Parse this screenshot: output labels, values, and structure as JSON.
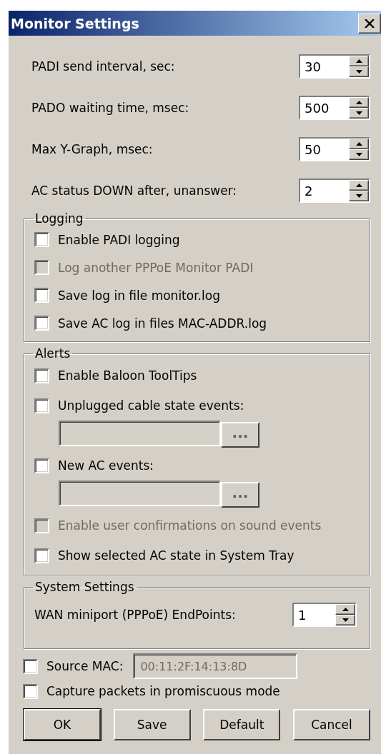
{
  "window": {
    "title": "Monitor Settings"
  },
  "spinners": [
    {
      "label": "PADI send interval, sec:",
      "value": "30"
    },
    {
      "label": "PADO waiting time, msec:",
      "value": "500"
    },
    {
      "label": "Max Y-Graph, msec:",
      "value": "50"
    },
    {
      "label": "AC status DOWN after, unanswer:",
      "value": "2"
    }
  ],
  "logging": {
    "title": "Logging",
    "items": [
      {
        "kind": "checkbox",
        "label": "Enable PADI logging",
        "checked": false,
        "disabled": false
      },
      {
        "kind": "checkbox",
        "label": "Log another PPPoE Monitor PADI",
        "checked": false,
        "disabled": true
      },
      {
        "kind": "checkbox",
        "label": "Save log in file monitor.log",
        "checked": false,
        "disabled": false
      },
      {
        "kind": "checkbox",
        "label": "Save AC log in files MAC-ADDR.log",
        "checked": false,
        "disabled": false
      }
    ]
  },
  "alerts": {
    "title": "Alerts",
    "items": [
      {
        "kind": "checkbox",
        "label": "Enable Baloon ToolTips",
        "checked": false,
        "disabled": false
      },
      {
        "kind": "checkbox",
        "label": "Unplugged cable state events:",
        "checked": false,
        "disabled": false
      },
      {
        "kind": "path",
        "disabled": true,
        "browse": "..."
      },
      {
        "kind": "checkbox",
        "label": "New AC events:",
        "checked": false,
        "disabled": false
      },
      {
        "kind": "path",
        "disabled": true,
        "browse": "..."
      },
      {
        "kind": "checkbox",
        "label": "Enable user confirmations on sound events",
        "checked": false,
        "disabled": true
      },
      {
        "kind": "checkbox",
        "label": "Show selected AC state in System Tray",
        "checked": false,
        "disabled": false
      }
    ]
  },
  "system": {
    "title": "System Settings",
    "spinners": [
      {
        "label": "WAN miniport (PPPoE) EndPoints:",
        "value": "1"
      }
    ]
  },
  "source_mac": {
    "label": "Source MAC:",
    "checked": false,
    "value": "00:11:2F:14:13:8D",
    "disabled": true
  },
  "capture": {
    "label": "Capture packets in promiscuous mode",
    "checked": false
  },
  "buttons": [
    {
      "label": "OK",
      "default": true
    },
    {
      "label": "Save",
      "default": false
    },
    {
      "label": "Default",
      "default": false
    },
    {
      "label": "Cancel",
      "default": false
    }
  ]
}
